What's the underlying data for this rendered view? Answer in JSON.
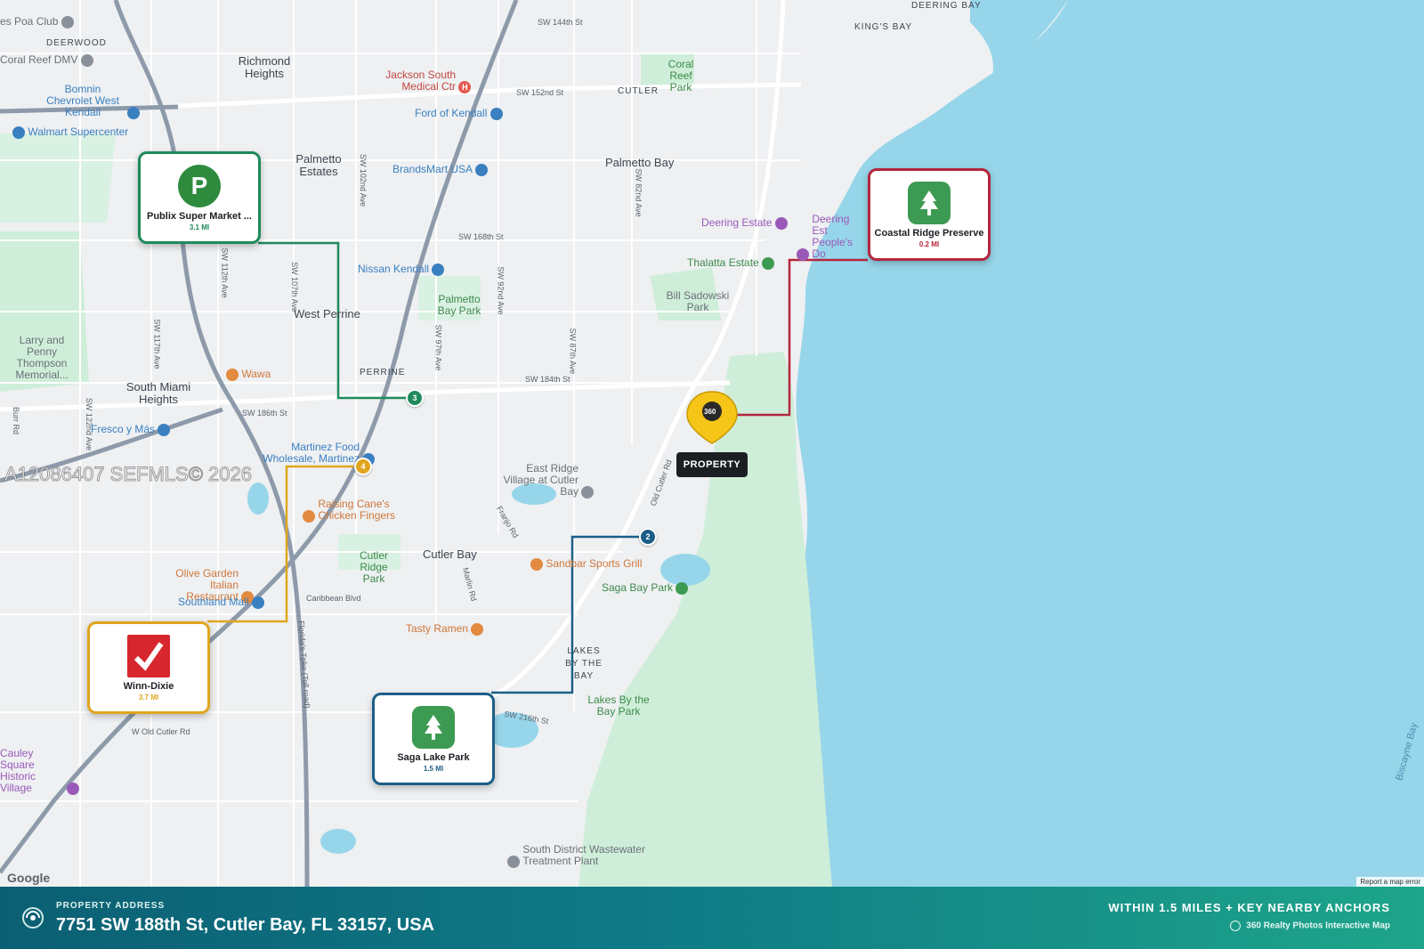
{
  "colors": {
    "water": "#97d6ea",
    "land": "#eef0f2",
    "park": "#cfeed9",
    "publix_route": "#1f8a5c",
    "coastal_route": "#b3263d",
    "winn_route": "#e0a51e",
    "saga_route": "#1b5e87",
    "footer_start": "#0b5f73",
    "footer_end": "#1ea58a"
  },
  "property": {
    "tag": "PROPERTY",
    "pin_badge": "360"
  },
  "anchors": [
    {
      "name": "Publix Super Market ...",
      "distance": "3.1 MI",
      "icon": "publix-logo-icon",
      "route_number": "3",
      "logo_letter": "P"
    },
    {
      "name": "Coastal Ridge Preserve",
      "distance": "0.2 MI",
      "icon": "tree-icon"
    },
    {
      "name": "Winn-Dixie",
      "distance": "3.7 MI",
      "icon": "checkmark-logo-icon",
      "route_number": "4"
    },
    {
      "name": "Saga Lake Park",
      "distance": "1.5 MI",
      "icon": "tree-icon",
      "route_number": "2"
    }
  ],
  "map_labels": {
    "areas": [
      "Richmond Heights",
      "Palmetto Estates",
      "Palmetto Bay",
      "West Perrine",
      "South Miami Heights",
      "Cutler Bay",
      "PERRINE",
      "CUTLER",
      "DEERWOOD",
      "KING'S BAY",
      "DEERING BAY",
      "LAKES BY THE BAY",
      "Lakes By the Bay Park",
      "Bill Sadowski Park",
      "Coral Reef Park",
      "Palmetto Bay Park",
      "Cutler Ridge Park",
      "Larry and Penny Thompson Memorial..."
    ],
    "pois": [
      "Jackson South Medical Ctr",
      "Coral Reef DMV",
      "Bomnin Chevrolet West Kendall",
      "Walmart Supercenter",
      "Ford of Kendall",
      "BrandsMart USA",
      "Deering Estate",
      "Deering Est People's Do",
      "Thalatta Estate",
      "Nissan Kendall",
      "Wawa",
      "Fresco y Más",
      "Martinez Food Wholesale, Martinez",
      "Raising Cane's Chicken Fingers",
      "East Ridge Village at Cutler Bay",
      "Sandbar Sports Grill",
      "Saga Bay Park",
      "Olive Garden Italian Restaurant",
      "Southland Mall",
      "Tasty Ramen",
      "Cauley Square Historic Village",
      "South District Wastewater Treatment Plant",
      "es Poa Club",
      "Biscayne Bay"
    ],
    "streets": [
      "SW 144th St",
      "SW 152nd St",
      "SW 168th St",
      "SW 184th St",
      "SW 186th St",
      "SW 216th St",
      "Caribbean Blvd",
      "Old Cutler Rd",
      "SW 87th Ave",
      "SW 92nd Ave",
      "SW 97th Ave",
      "SW 107th Ave",
      "SW 112th Ave",
      "SW 117th Ave",
      "SW 122nd Ave",
      "Florida's Tpke (Toll road)",
      "Franjo Rd",
      "Marlin Rd",
      "W Old Cutler Rd",
      "SW 82nd Ave",
      "SW 102nd Ave",
      "Burr Rd"
    ]
  },
  "map_footer": {
    "watermark": "A12086407 SEFMLS© 2026",
    "google": "Google",
    "report": "Report a map error"
  },
  "footer": {
    "address_label": "PROPERTY ADDRESS",
    "address": "7751 SW 188th St, Cutler Bay, FL 33157, USA",
    "right_title": "WITHIN 1.5 MILES + KEY NEARBY ANCHORS",
    "right_sub": "360 Realty Photos Interactive Map"
  }
}
